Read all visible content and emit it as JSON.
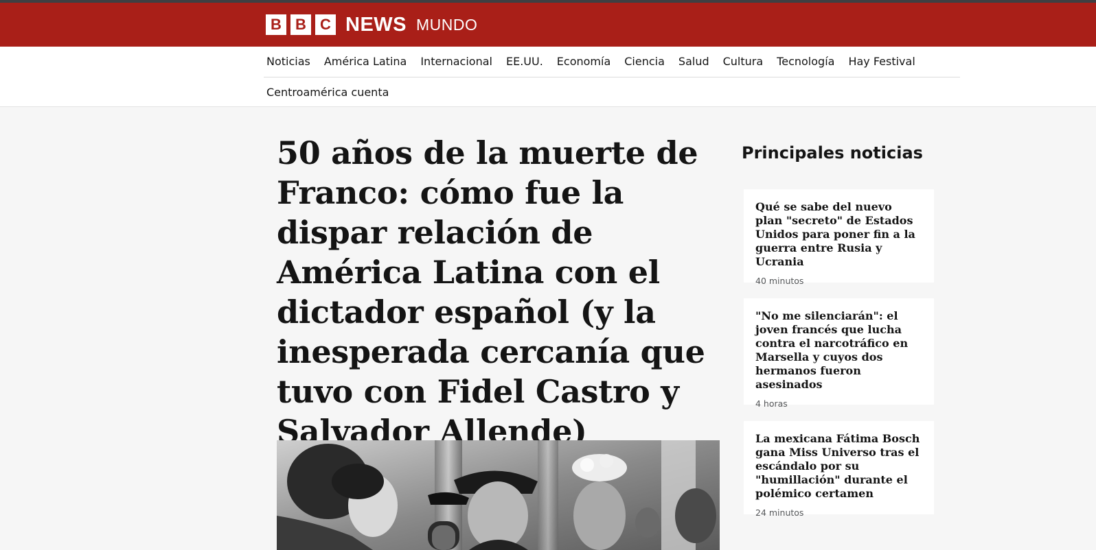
{
  "header": {
    "logo_letters": [
      "B",
      "B",
      "C"
    ],
    "logo_news": "NEWS",
    "logo_section": "MUNDO",
    "brand_color": "#a91f18"
  },
  "nav": {
    "items": [
      {
        "label": "Noticias"
      },
      {
        "label": "América Latina"
      },
      {
        "label": "Internacional"
      },
      {
        "label": "EE.UU."
      },
      {
        "label": "Economía"
      },
      {
        "label": "Ciencia"
      },
      {
        "label": "Salud"
      },
      {
        "label": "Cultura"
      },
      {
        "label": "Tecnología"
      },
      {
        "label": "Hay Festival"
      }
    ],
    "second_row": [
      {
        "label": "Centroamérica cuenta"
      }
    ]
  },
  "article": {
    "headline": "50 años de la muerte de Franco: cómo fue la dispar relación de América Latina con el dictador español (y la inesperada cercanía que tuvo con Fidel Castro y Salvador Allende)",
    "hero_image": "black-and-white-photo"
  },
  "sidebar": {
    "title": "Principales noticias",
    "stories": [
      {
        "title": "Qué se sabe del nuevo plan \"secreto\" de Estados Unidos para poner fin a la guerra entre Rusia y Ucrania",
        "time": "40 minutos"
      },
      {
        "title": "\"No me silenciarán\": el joven francés que lucha contra el narcotráfico en Marsella y cuyos dos hermanos fueron asesinados",
        "time": "4 horas"
      },
      {
        "title": "La mexicana Fátima Bosch gana Miss Universo tras el escándalo por su \"humillación\" durante el polémico certamen",
        "time": "24 minutos"
      }
    ]
  }
}
